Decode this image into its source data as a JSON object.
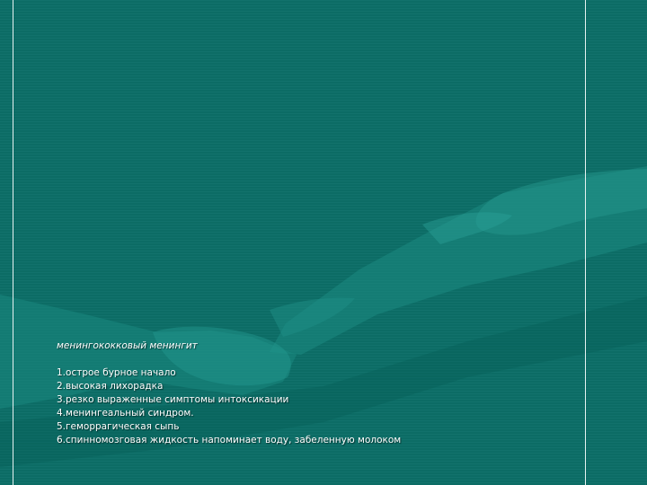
{
  "slide": {
    "title": "менингококковый менингит",
    "items": [
      "1.острое бурное начало",
      "2.высокая лихорадка",
      "3.резко выраженные симптомы интоксикации",
      "4.менингеальный синдром.",
      "5.геморрагическая сыпь",
      "6.спинномозговая жидкость напоминает воду, забеленную молоком"
    ]
  },
  "colors": {
    "background": "#0c6f68",
    "text": "#ffffff",
    "rule": "#e6f2f1"
  }
}
